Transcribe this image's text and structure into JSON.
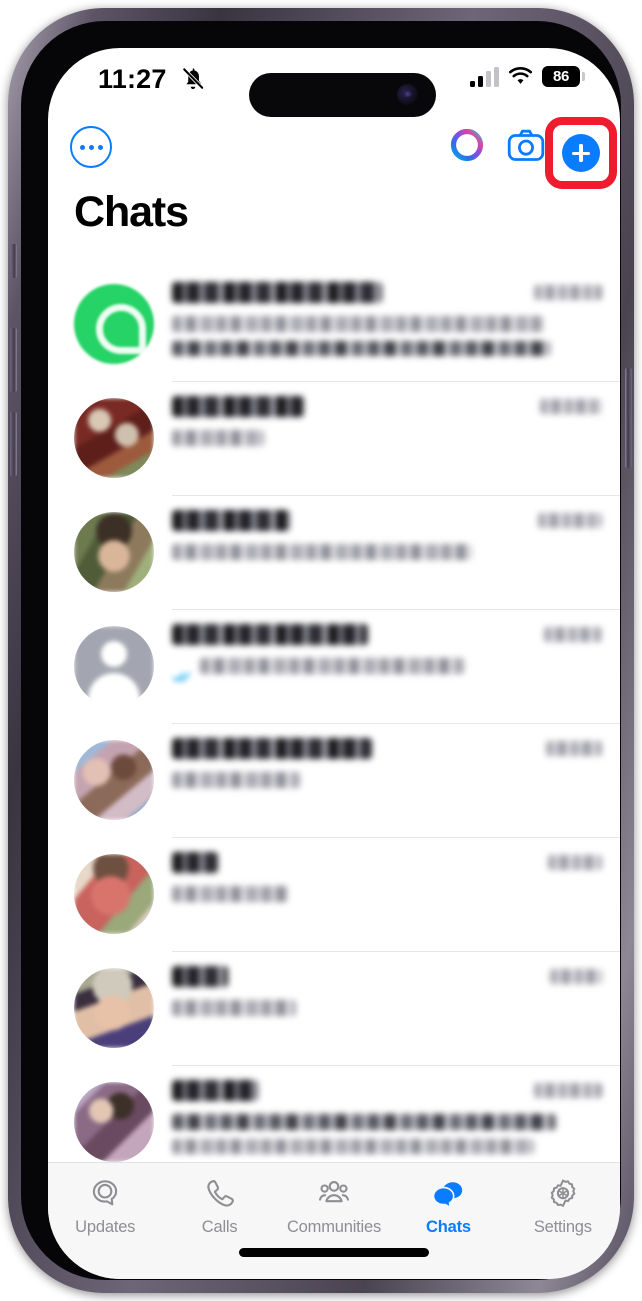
{
  "device": {
    "model": "iphone-15-pro",
    "frame_color": "#4a4350"
  },
  "status_bar": {
    "time": "11:27",
    "silent_icon": "bell-slash-icon",
    "signal_icon": "cellular-signal-icon",
    "signal_bars_filled": 2,
    "signal_bars_total": 4,
    "wifi_icon": "wifi-icon",
    "battery_level": "86",
    "battery_icon": "battery-icon"
  },
  "app_header": {
    "more_icon": "ellipsis-circle-icon",
    "meta_ai_icon": "meta-ai-ring-icon",
    "camera_icon": "camera-icon",
    "new_chat_icon": "plus-circle-icon",
    "highlight_color": "#ee1c2e",
    "accent_color": "#0a7cff"
  },
  "page": {
    "title": "Chats"
  },
  "chat_list": {
    "privacy_note": "all chat names, message previews and timestamps are pixelated / blurred in the screenshot",
    "rows": [
      {
        "name": "",
        "preview": "",
        "time": "",
        "avatar": "whatsapp-logo-avatar",
        "avatar_color": "#25d366",
        "lines": 2,
        "read_ticks": false
      },
      {
        "name": "",
        "preview": "",
        "time": "",
        "avatar": "photo-avatar-maroon",
        "avatar_color": "#7a2a24",
        "lines": 1,
        "read_ticks": false
      },
      {
        "name": "",
        "preview": "",
        "time": "",
        "avatar": "photo-avatar-outdoors",
        "avatar_color": "#5d6b4a",
        "lines": 1,
        "read_ticks": false
      },
      {
        "name": "",
        "preview": "",
        "time": "",
        "avatar": "default-person-avatar",
        "avatar_color": "#a3a6b0",
        "lines": 1,
        "read_ticks": true
      },
      {
        "name": "",
        "preview": "",
        "time": "",
        "avatar": "photo-avatar-group",
        "avatar_color": "#b49aa6",
        "lines": 1,
        "read_ticks": false
      },
      {
        "name": "",
        "preview": "",
        "time": "",
        "avatar": "photo-avatar-red",
        "avatar_color": "#c8635e",
        "lines": 1,
        "read_ticks": false
      },
      {
        "name": "",
        "preview": "",
        "time": "",
        "avatar": "photo-avatar-portrait",
        "avatar_color": "#9a9a86",
        "lines": 1,
        "read_ticks": false
      },
      {
        "name": "",
        "preview": "",
        "time": "",
        "avatar": "photo-avatar-purple",
        "avatar_color": "#8b6a86",
        "lines": 2,
        "read_ticks": false
      }
    ]
  },
  "tab_bar": {
    "active": "Chats",
    "tabs": [
      {
        "label": "Updates",
        "icon": "updates-icon"
      },
      {
        "label": "Calls",
        "icon": "phone-icon"
      },
      {
        "label": "Communities",
        "icon": "communities-icon"
      },
      {
        "label": "Chats",
        "icon": "chat-bubbles-icon"
      },
      {
        "label": "Settings",
        "icon": "gear-icon"
      }
    ]
  }
}
